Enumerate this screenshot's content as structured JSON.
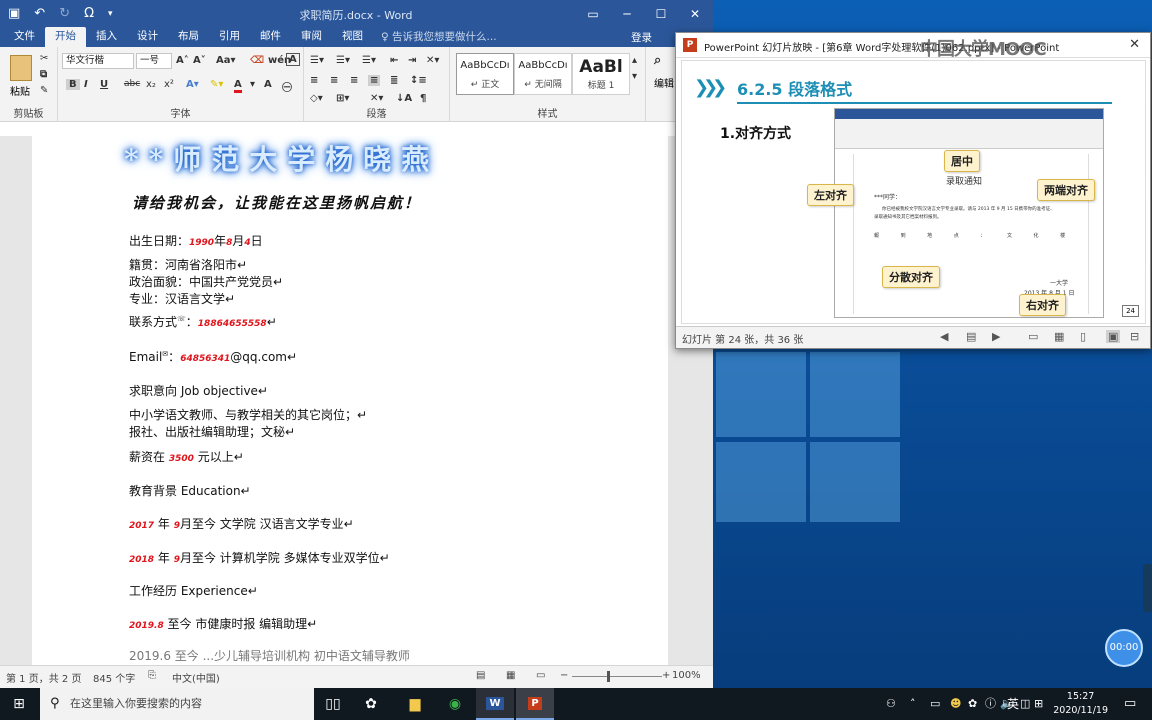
{
  "word": {
    "title": "求职简历.docx - Word",
    "qat": {
      "undo": "↶",
      "redo": "↻",
      "omega": "Ω"
    },
    "tabs": [
      "文件",
      "开始",
      "插入",
      "设计",
      "布局",
      "引用",
      "邮件",
      "审阅",
      "视图"
    ],
    "active_tab": "开始",
    "tell_me": "告诉我您想要做什么...",
    "login": "登录",
    "clipboard": {
      "paste": "粘贴",
      "label": "剪贴板"
    },
    "font": {
      "family": "华文行楷",
      "size": "一号",
      "label": "字体",
      "format_buttons": [
        "B",
        "I",
        "U",
        "abc",
        "x₂",
        "x²"
      ]
    },
    "paragraph": {
      "label": "段落"
    },
    "styles": {
      "label": "样式",
      "items": [
        {
          "preview": "AaBbCcDı",
          "name": "↵ 正文"
        },
        {
          "preview": "AaBbCcDı",
          "name": "↵ 无间隔"
        },
        {
          "preview": "AaBl",
          "name": "标题 1"
        }
      ]
    },
    "edit_label": "编辑",
    "doc": {
      "header_title": "**师范大学杨晓燕",
      "motto": "请给我机会，让我能在这里扬帆启航！",
      "birth": {
        "label": "出生日期：",
        "year": "1990",
        "y": "年",
        "month": "8",
        "m": "月",
        "day": "4",
        "d": "日"
      },
      "origin": "籍贯：河南省洛阳市↵",
      "politics": "政治面貌：中国共产党党员↵",
      "major": "专业：汉语言文学↵",
      "contact": {
        "label": "联系方式",
        "sup": "☏",
        "colon": "：",
        "value": "18864655558",
        "end": "↵"
      },
      "email": {
        "label": "Email",
        "sup": "✉",
        "colon": "：",
        "value": "64856341",
        "domain": "@qq.com",
        "end": "↵"
      },
      "objective": "求职意向  Job objective↵",
      "jobs1": "中小学语文教师、与教学相关的其它岗位；↵",
      "jobs2": "报社、出版社编辑助理；文秘↵",
      "salary": {
        "label": "薪资在 ",
        "value": "3500",
        "rest": " 元以上↵"
      },
      "education": "教育背景  Education↵",
      "edu1": {
        "year": "2017",
        "y": " 年 ",
        "month": "9",
        "rest": "月至今  文学院  汉语言文学专业↵"
      },
      "edu2": {
        "year": "2018",
        "y": " 年 ",
        "month": "9",
        "rest": "月至今  计算机学院  多媒体专业双学位↵"
      },
      "work": "工作经历  Experience↵",
      "work1": {
        "date": "2019.8",
        "rest": " 至今  市健康时报  编辑助理↵"
      },
      "partial": "2019.6  至今  ...少儿辅导培训机构  初中语文辅导教师"
    },
    "status": {
      "page": "第 1 页，共 2 页",
      "words": "845 个字",
      "lang": "中文(中国)",
      "zoom": "100%"
    }
  },
  "ppt": {
    "title": "PowerPoint 幻灯片放映 - [第6章 Word字处理软件(1)062.pptx] - PowerPoint",
    "watermark": "中国大学MOOC",
    "slide": {
      "section": "6.2.5  段落格式",
      "subtitle": "1.对齐方式",
      "mini_doc_title": "录取通知",
      "mini_line1": "***同学：",
      "mini_line2": "你已经被我校文学院汉语言文学专业录取。请与 2013 年 9 月 15 日携带你的准考证、",
      "mini_line3": "录取通知书及其它档案材料报到。",
      "mini_spread": "報  到  地  点  ：  文  化  楼",
      "mini_sign": "一大学",
      "mini_date": "2013 年 8 月 1 日",
      "callouts": {
        "center": "居中",
        "left": "左对齐",
        "justify": "两端对齐",
        "distributed": "分散对齐",
        "right": "右对齐"
      },
      "page_number": "24"
    },
    "status": "幻灯片 第 24 张，共 36 张"
  },
  "timer": "00:00",
  "taskbar": {
    "search_placeholder": "在这里输入你要搜索的内容",
    "ime": "英",
    "time": "15:27",
    "date": "2020/11/19"
  }
}
